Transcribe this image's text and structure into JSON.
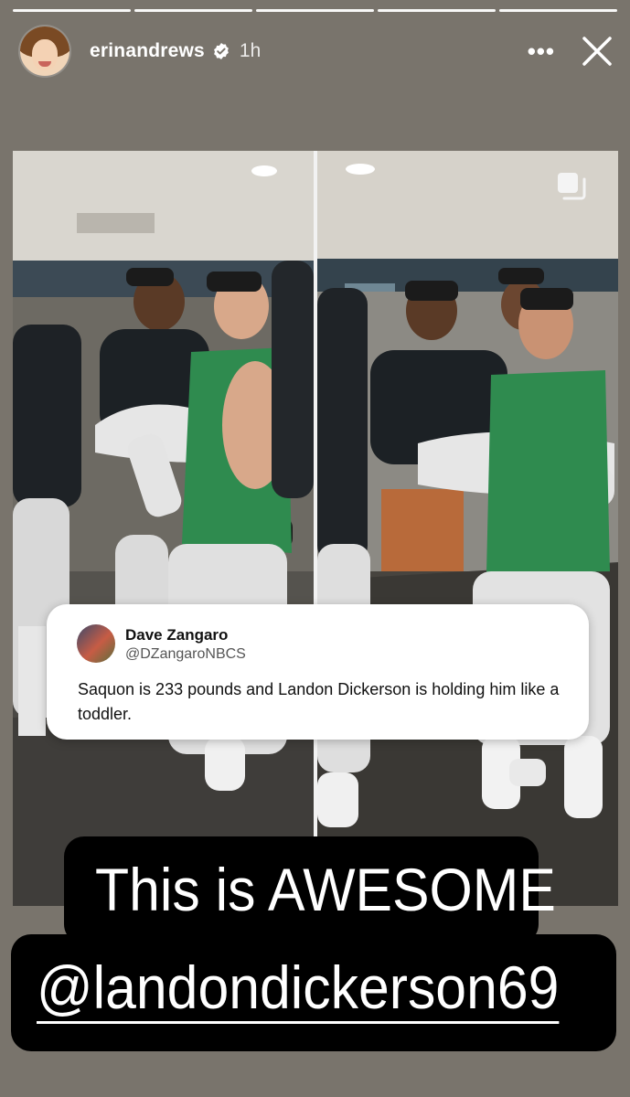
{
  "story": {
    "progress_segments": 5,
    "progress_completed": 5,
    "username": "erinandrews",
    "verified": true,
    "time_ago": "1h",
    "more_icon": "more-icon",
    "close_icon": "close-icon"
  },
  "tweet": {
    "name": "Dave Zangaro",
    "handle": "@DZangaroNBCS",
    "text": "Saquon is 233 pounds and Landon Dickerson is holding him like a toddler."
  },
  "captions": {
    "line1": "This is AWESOME",
    "line2": "@landondickerson69"
  },
  "colors": {
    "background": "#79746c",
    "jersey_green": "#2f8b4f",
    "caption_bg": "#000000"
  }
}
